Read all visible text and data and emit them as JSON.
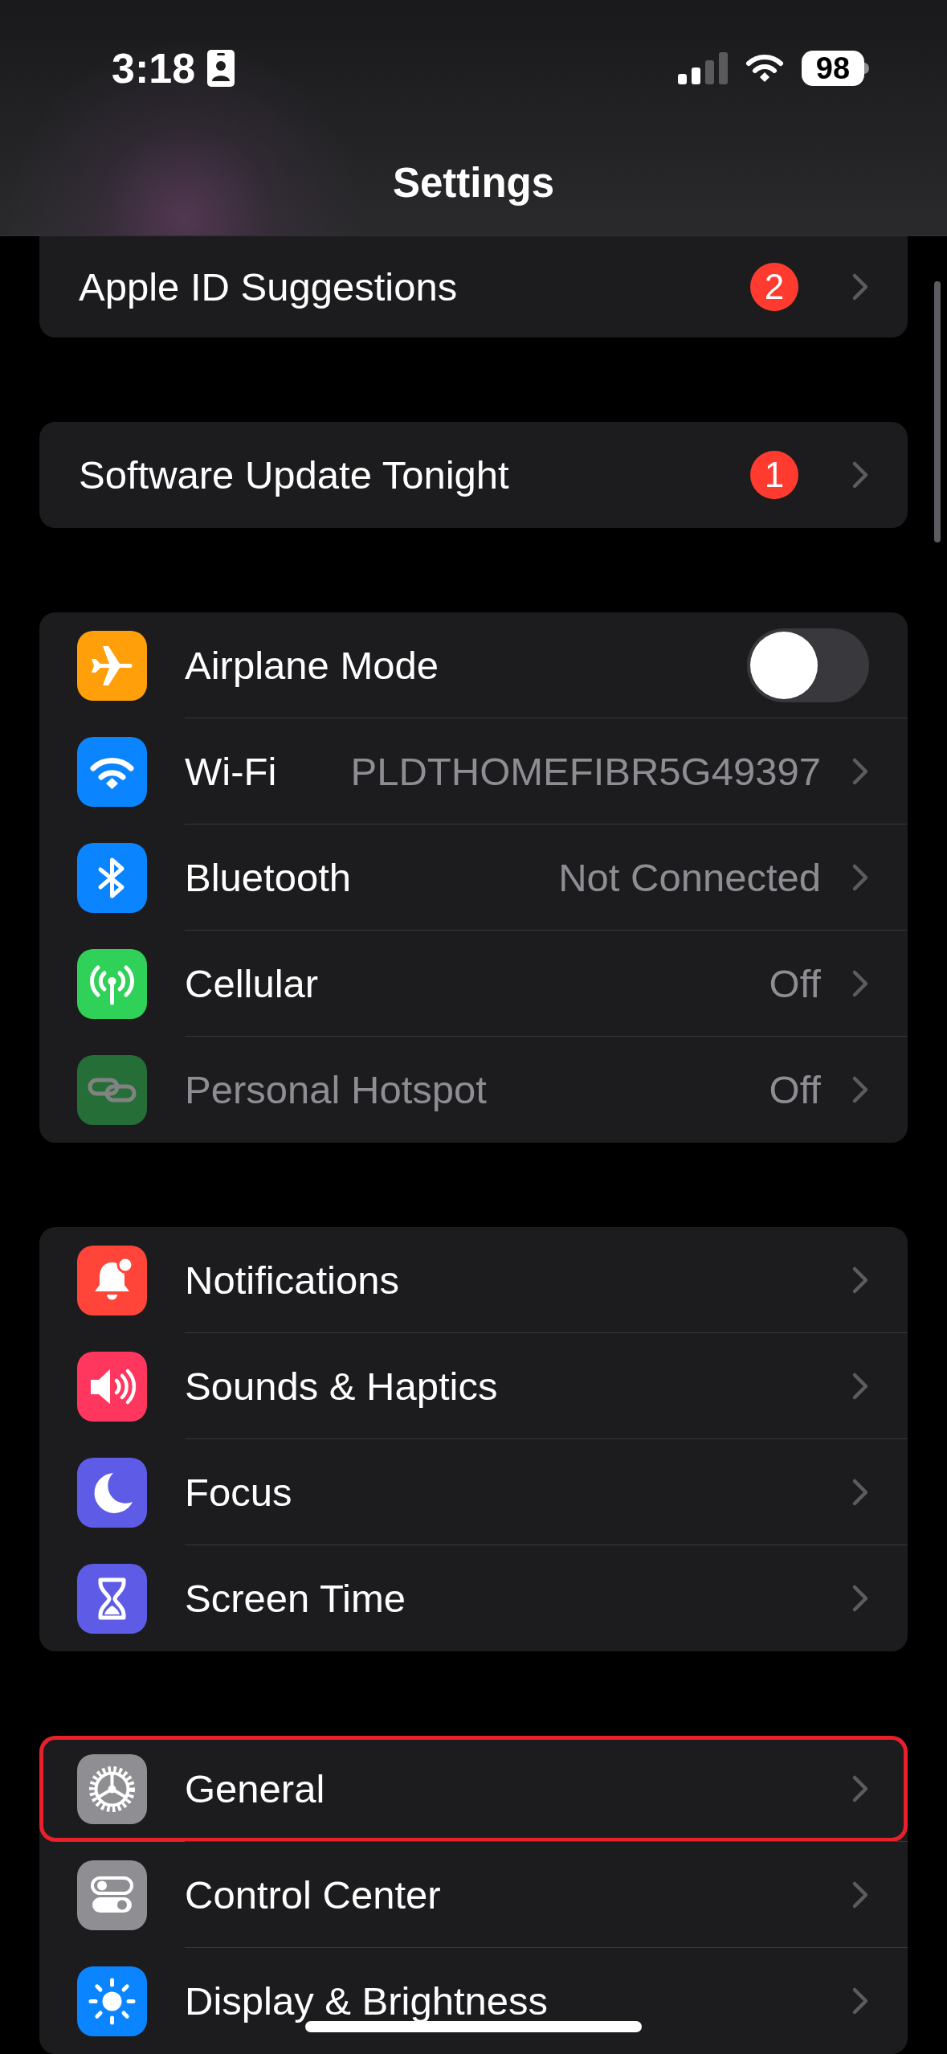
{
  "status_bar": {
    "time": "3:18",
    "battery": "98"
  },
  "title": "Settings",
  "groups": [
    {
      "rows": [
        {
          "kind": "link",
          "label": "Apple ID Suggestions",
          "badge": "2",
          "disabled": false,
          "highlighted": false
        }
      ]
    },
    {
      "rows": [
        {
          "kind": "link",
          "label": "Software Update Tonight",
          "badge": "1",
          "disabled": false,
          "highlighted": false
        }
      ]
    },
    {
      "rows": [
        {
          "kind": "toggle",
          "label": "Airplane Mode",
          "on": false,
          "disabled": false,
          "highlighted": false
        },
        {
          "kind": "link",
          "label": "Wi-Fi",
          "value": "PLDTHOMEFIBR5G49397",
          "disabled": false,
          "highlighted": false
        },
        {
          "kind": "link",
          "label": "Bluetooth",
          "value": "Not Connected",
          "disabled": false,
          "highlighted": false
        },
        {
          "kind": "link",
          "label": "Cellular",
          "value": "Off",
          "disabled": false,
          "highlighted": false
        },
        {
          "kind": "link",
          "label": "Personal Hotspot",
          "value": "Off",
          "disabled": true,
          "highlighted": false
        }
      ]
    },
    {
      "rows": [
        {
          "kind": "link",
          "label": "Notifications",
          "disabled": false,
          "highlighted": false
        },
        {
          "kind": "link",
          "label": "Sounds & Haptics",
          "disabled": false,
          "highlighted": false
        },
        {
          "kind": "link",
          "label": "Focus",
          "disabled": false,
          "highlighted": false
        },
        {
          "kind": "link",
          "label": "Screen Time",
          "disabled": false,
          "highlighted": false
        }
      ]
    },
    {
      "rows": [
        {
          "kind": "link",
          "label": "General",
          "disabled": false,
          "highlighted": true
        },
        {
          "kind": "link",
          "label": "Control Center",
          "disabled": false,
          "highlighted": false
        },
        {
          "kind": "link",
          "label": "Display & Brightness",
          "disabled": false,
          "highlighted": false
        }
      ]
    }
  ]
}
